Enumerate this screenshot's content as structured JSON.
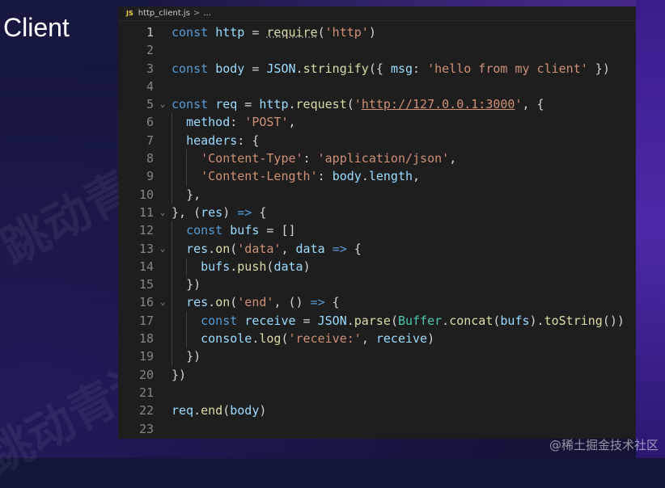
{
  "slide": {
    "title": "Client"
  },
  "background_watermark": "跳动青训",
  "editor": {
    "tab": {
      "icon": "JS",
      "filename": "http_client.js",
      "separator": ">",
      "breadcrumb": "..."
    },
    "lines": [
      {
        "n": "1",
        "fold": "",
        "indent": 0,
        "tokens": [
          [
            "kw",
            "const "
          ],
          [
            "var",
            "http"
          ],
          [
            "pun",
            " = "
          ],
          [
            "fn",
            "require",
            "und"
          ],
          [
            "pun",
            "("
          ],
          [
            "str",
            "'http'"
          ],
          [
            "pun",
            ")"
          ]
        ]
      },
      {
        "n": "2",
        "fold": "",
        "indent": 0,
        "tokens": []
      },
      {
        "n": "3",
        "fold": "",
        "indent": 0,
        "tokens": [
          [
            "kw",
            "const "
          ],
          [
            "var",
            "body"
          ],
          [
            "pun",
            " = "
          ],
          [
            "var",
            "JSON"
          ],
          [
            "pun",
            "."
          ],
          [
            "fn",
            "stringify"
          ],
          [
            "pun",
            "({ "
          ],
          [
            "var",
            "msg"
          ],
          [
            "pun",
            ": "
          ],
          [
            "str",
            "'hello from my client'"
          ],
          [
            "pun",
            " })"
          ]
        ]
      },
      {
        "n": "4",
        "fold": "",
        "indent": 0,
        "tokens": []
      },
      {
        "n": "5",
        "fold": "⌄",
        "indent": 0,
        "tokens": [
          [
            "kw",
            "const "
          ],
          [
            "var",
            "req"
          ],
          [
            "pun",
            " = "
          ],
          [
            "var",
            "http"
          ],
          [
            "pun",
            "."
          ],
          [
            "fn",
            "request"
          ],
          [
            "pun",
            "("
          ],
          [
            "str",
            "'"
          ],
          [
            "url",
            "http://127.0.0.1:3000"
          ],
          [
            "str",
            "'"
          ],
          [
            "pun",
            ", {"
          ]
        ]
      },
      {
        "n": "6",
        "fold": "",
        "indent": 1,
        "tokens": [
          [
            "var",
            "method"
          ],
          [
            "pun",
            ": "
          ],
          [
            "str",
            "'POST'"
          ],
          [
            "pun",
            ","
          ]
        ]
      },
      {
        "n": "7",
        "fold": "",
        "indent": 1,
        "tokens": [
          [
            "var",
            "headers"
          ],
          [
            "pun",
            ": {"
          ]
        ]
      },
      {
        "n": "8",
        "fold": "",
        "indent": 2,
        "tokens": [
          [
            "str",
            "'Content-Type'"
          ],
          [
            "pun",
            ": "
          ],
          [
            "str",
            "'application/json'"
          ],
          [
            "pun",
            ","
          ]
        ]
      },
      {
        "n": "9",
        "fold": "",
        "indent": 2,
        "tokens": [
          [
            "str",
            "'Content-Length'"
          ],
          [
            "pun",
            ": "
          ],
          [
            "var",
            "body"
          ],
          [
            "pun",
            "."
          ],
          [
            "var",
            "length"
          ],
          [
            "pun",
            ","
          ]
        ]
      },
      {
        "n": "10",
        "fold": "",
        "indent": 1,
        "tokens": [
          [
            "pun",
            "},"
          ]
        ]
      },
      {
        "n": "11",
        "fold": "⌄",
        "indent": 0,
        "tokens": [
          [
            "pun",
            "}, ("
          ],
          [
            "var",
            "res"
          ],
          [
            "pun",
            ") "
          ],
          [
            "kw",
            "=>"
          ],
          [
            "pun",
            " {"
          ]
        ]
      },
      {
        "n": "12",
        "fold": "",
        "indent": 1,
        "tokens": [
          [
            "kw",
            "const "
          ],
          [
            "var",
            "bufs"
          ],
          [
            "pun",
            " = []"
          ]
        ]
      },
      {
        "n": "13",
        "fold": "⌄",
        "indent": 1,
        "tokens": [
          [
            "var",
            "res"
          ],
          [
            "pun",
            "."
          ],
          [
            "fn",
            "on"
          ],
          [
            "pun",
            "("
          ],
          [
            "str",
            "'data'"
          ],
          [
            "pun",
            ", "
          ],
          [
            "var",
            "data"
          ],
          [
            "pun",
            " "
          ],
          [
            "kw",
            "=>"
          ],
          [
            "pun",
            " {"
          ]
        ]
      },
      {
        "n": "14",
        "fold": "",
        "indent": 2,
        "tokens": [
          [
            "var",
            "bufs"
          ],
          [
            "pun",
            "."
          ],
          [
            "fn",
            "push"
          ],
          [
            "pun",
            "("
          ],
          [
            "var",
            "data"
          ],
          [
            "pun",
            ")"
          ]
        ]
      },
      {
        "n": "15",
        "fold": "",
        "indent": 1,
        "tokens": [
          [
            "pun",
            "})"
          ]
        ]
      },
      {
        "n": "16",
        "fold": "⌄",
        "indent": 1,
        "tokens": [
          [
            "var",
            "res"
          ],
          [
            "pun",
            "."
          ],
          [
            "fn",
            "on"
          ],
          [
            "pun",
            "("
          ],
          [
            "str",
            "'end'"
          ],
          [
            "pun",
            ", () "
          ],
          [
            "kw",
            "=>"
          ],
          [
            "pun",
            " {"
          ]
        ]
      },
      {
        "n": "17",
        "fold": "",
        "indent": 2,
        "tokens": [
          [
            "kw",
            "const "
          ],
          [
            "var",
            "receive"
          ],
          [
            "pun",
            " = "
          ],
          [
            "var",
            "JSON"
          ],
          [
            "pun",
            "."
          ],
          [
            "fn",
            "parse"
          ],
          [
            "pun",
            "("
          ],
          [
            "cls",
            "Buffer"
          ],
          [
            "pun",
            "."
          ],
          [
            "fn",
            "concat"
          ],
          [
            "pun",
            "("
          ],
          [
            "var",
            "bufs"
          ],
          [
            "pun",
            ")."
          ],
          [
            "fn",
            "toString"
          ],
          [
            "pun",
            "())"
          ]
        ]
      },
      {
        "n": "18",
        "fold": "",
        "indent": 2,
        "tokens": [
          [
            "var",
            "console"
          ],
          [
            "pun",
            "."
          ],
          [
            "fn",
            "log"
          ],
          [
            "pun",
            "("
          ],
          [
            "str",
            "'receive:'"
          ],
          [
            "pun",
            ", "
          ],
          [
            "var",
            "receive"
          ],
          [
            "pun",
            ")"
          ]
        ]
      },
      {
        "n": "19",
        "fold": "",
        "indent": 1,
        "tokens": [
          [
            "pun",
            "})"
          ]
        ]
      },
      {
        "n": "20",
        "fold": "",
        "indent": 0,
        "tokens": [
          [
            "pun",
            "})"
          ]
        ]
      },
      {
        "n": "21",
        "fold": "",
        "indent": 0,
        "tokens": []
      },
      {
        "n": "22",
        "fold": "",
        "indent": 0,
        "tokens": [
          [
            "var",
            "req"
          ],
          [
            "pun",
            "."
          ],
          [
            "fn",
            "end"
          ],
          [
            "pun",
            "("
          ],
          [
            "var",
            "body"
          ],
          [
            "pun",
            ")"
          ]
        ]
      },
      {
        "n": "23",
        "fold": "",
        "indent": 0,
        "tokens": []
      }
    ]
  },
  "watermark": "@稀土掘金技术社区",
  "colors": {
    "editor_bg": "#1e1e1e",
    "keyword": "#569cd6",
    "variable": "#9cdcfe",
    "function": "#dcdcaa",
    "string": "#ce9178",
    "class": "#4ec9b0"
  }
}
